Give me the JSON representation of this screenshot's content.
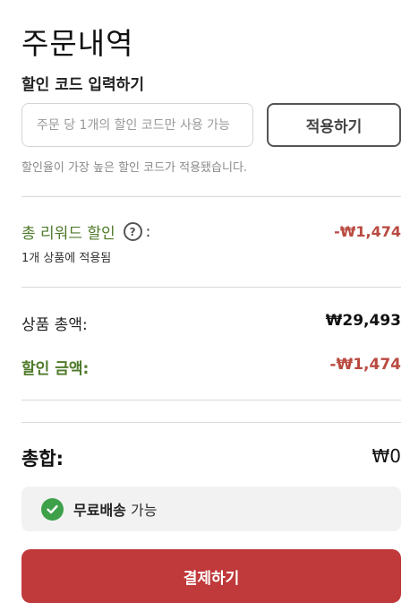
{
  "header": {
    "title": "주문내역"
  },
  "coupon": {
    "label": "할인 코드 입력하기",
    "placeholder": "주문 당 1개의 할인 코드만 사용 가능",
    "value": "",
    "apply_label": "적용하기",
    "note": "할인율이 가장 높은 할인 코드가 적용됐습니다."
  },
  "reward": {
    "label": "총 리워드 할인",
    "help_icon": "question-circle-icon",
    "help_glyph": "?",
    "colon": ":",
    "value": "-₩1,474",
    "sub": "1개 상품에 적용됨"
  },
  "summary": {
    "subtotal_label": "상품 총액:",
    "subtotal_value": "₩29,493",
    "discount_label": "할인 금액:",
    "discount_value": "-₩1,474",
    "total_label": "총합:",
    "total_value": "₩0"
  },
  "shipping": {
    "icon": "check-circle-icon",
    "strong": "무료배송",
    "text": " 가능"
  },
  "checkout": {
    "label": "결제하기"
  },
  "colors": {
    "accent": "#c0393b",
    "discount_red": "#b94a40",
    "reward_green": "#4f7a2a",
    "check_green": "#3ea14a"
  }
}
